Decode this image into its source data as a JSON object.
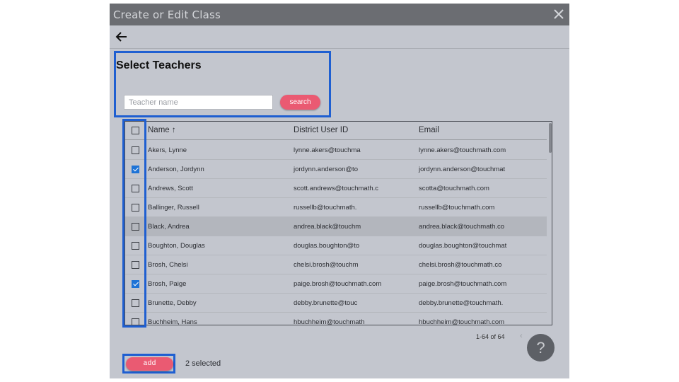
{
  "window": {
    "title": "Create or Edit Class",
    "close_icon": "close-icon"
  },
  "nav": {
    "back_icon": "arrow-left-icon"
  },
  "panel": {
    "heading": "Select Teachers",
    "search_placeholder": "Teacher name",
    "search_value": "",
    "search_label": "search"
  },
  "table": {
    "columns": {
      "name": "Name",
      "sort_icon": "↑",
      "district_id": "District User ID",
      "email": "Email"
    },
    "select_all_checked": false,
    "rows": [
      {
        "name": "Akers, Lynne",
        "district_id": "lynne.akers@touchma",
        "email": "lynne.akers@touchmath.com",
        "checked": false
      },
      {
        "name": "Anderson, Jordynn",
        "district_id": "jordynn.anderson@to",
        "email": "jordynn.anderson@touchmat",
        "checked": true
      },
      {
        "name": "Andrews, Scott",
        "district_id": "scott.andrews@touchmath.c",
        "email": "scotta@touchmath.com",
        "checked": false
      },
      {
        "name": "Ballinger, Russell",
        "district_id": "russellb@touchmath.",
        "email": "russellb@touchmath.com",
        "checked": false
      },
      {
        "name": "Black, Andrea",
        "district_id": "andrea.black@touchm",
        "email": "andrea.black@touchmath.co",
        "checked": false
      },
      {
        "name": "Boughton, Douglas",
        "district_id": "douglas.boughton@to",
        "email": "douglas.boughton@touchmat",
        "checked": false
      },
      {
        "name": "Brosh, Chelsi",
        "district_id": "chelsi.brosh@touchm",
        "email": "chelsi.brosh@touchmath.co",
        "checked": false
      },
      {
        "name": "Brosh, Paige",
        "district_id": "paige.brosh@touchmath.com",
        "email": "paige.brosh@touchmath.com",
        "checked": true
      },
      {
        "name": "Brunette, Debby",
        "district_id": "debby.brunette@touc",
        "email": "debby.brunette@touchmath.",
        "checked": false
      },
      {
        "name": "Buchheim, Hans",
        "district_id": "hbuchheim@touchmath",
        "email": "hbuchheim@touchmath.com",
        "checked": false
      }
    ]
  },
  "pagination": {
    "range": "1-64 of 64",
    "prev_icon": "‹"
  },
  "footer": {
    "add_label": "add",
    "selected_text": "2 selected"
  },
  "help": {
    "label": "?"
  },
  "colors": {
    "accent": "#ea5a72",
    "highlight": "#1f5fd1",
    "checkbox": "#1e73d6",
    "background": "#c3c6ce",
    "titlebar": "#6b6d72"
  }
}
